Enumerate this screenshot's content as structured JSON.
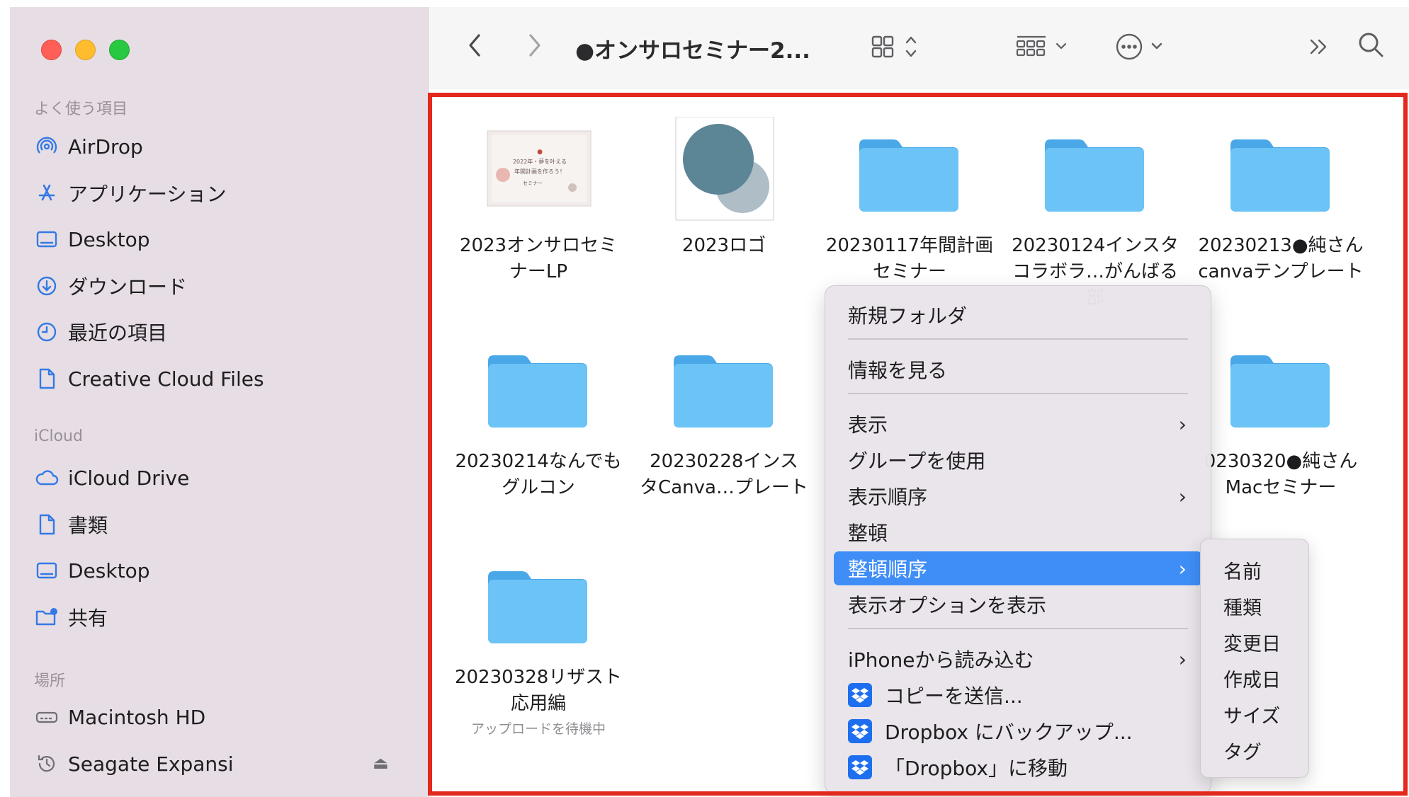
{
  "toolbar": {
    "title": "●オンサロセミナー2..."
  },
  "sidebar": {
    "favorites_header": "よく使う項目",
    "favorites": [
      {
        "label": "AirDrop",
        "icon": "airdrop-icon"
      },
      {
        "label": "アプリケーション",
        "icon": "applications-icon"
      },
      {
        "label": "Desktop",
        "icon": "desktop-icon"
      },
      {
        "label": "ダウンロード",
        "icon": "download-icon"
      },
      {
        "label": "最近の項目",
        "icon": "clock-icon"
      },
      {
        "label": "Creative Cloud Files",
        "icon": "document-icon"
      }
    ],
    "icloud_header": "iCloud",
    "icloud": [
      {
        "label": "iCloud Drive",
        "icon": "cloud-icon"
      },
      {
        "label": "書類",
        "icon": "document-icon"
      },
      {
        "label": "Desktop",
        "icon": "desktop-icon"
      },
      {
        "label": "共有",
        "icon": "shared-folder-icon"
      }
    ],
    "locations_header": "場所",
    "locations": [
      {
        "label": "Macintosh HD",
        "icon": "disk-icon"
      },
      {
        "label": "Seagate Expansi",
        "icon": "time-machine-icon"
      }
    ]
  },
  "files": [
    {
      "line1": "2023オンサロセミ",
      "line2": "ナーLP",
      "kind": "image"
    },
    {
      "line1": "2023ロゴ",
      "line2": "",
      "kind": "logo"
    },
    {
      "line1": "20230117年間計画",
      "line2": "セミナー",
      "kind": "folder"
    },
    {
      "line1": "20230124インスタ",
      "line2": "コラボラ…がんばる部",
      "kind": "folder"
    },
    {
      "line1": "20230213●純さん",
      "line2": "canvaテンプレート",
      "kind": "folder"
    },
    {
      "line1": "20230214なんでも",
      "line2": "グルコン",
      "kind": "folder"
    },
    {
      "line1": "20230228インス",
      "line2": "タCanva…プレート",
      "kind": "folder"
    },
    {
      "line1": "0230320●純さん",
      "line2": "Macセミナー",
      "kind": "folder"
    },
    {
      "line1": "20230328リザスト",
      "line2": "応用編",
      "status": "アップロードを待機中",
      "kind": "folder"
    }
  ],
  "thumbnail_text": {
    "line1": "2022年・夢を叶える",
    "line2": "年間計画を作ろう！",
    "line3": "セミナー"
  },
  "context_menu": {
    "items": [
      {
        "label": "新規フォルダ"
      },
      {
        "label": "情報を見る"
      },
      {
        "label": "表示"
      },
      {
        "label": "グループを使用"
      },
      {
        "label": "表示順序"
      },
      {
        "label": "整頓"
      },
      {
        "label": "整頓順序"
      },
      {
        "label": "表示オプションを表示"
      },
      {
        "label": "iPhoneから読み込む"
      },
      {
        "label": "コピーを送信..."
      },
      {
        "label": "Dropbox にバックアップ..."
      },
      {
        "label": "「Dropbox」に移動"
      }
    ],
    "arrow": "›"
  },
  "submenu": {
    "items": [
      "名前",
      "種類",
      "変更日",
      "作成日",
      "サイズ",
      "タグ"
    ]
  },
  "colors": {
    "sidebar_bg": "#e6dee4",
    "accent": "#3f8ef7",
    "folder": "#6cc3f5",
    "highlight_frame": "#e3281c",
    "dropbox": "#1e6ff0"
  }
}
